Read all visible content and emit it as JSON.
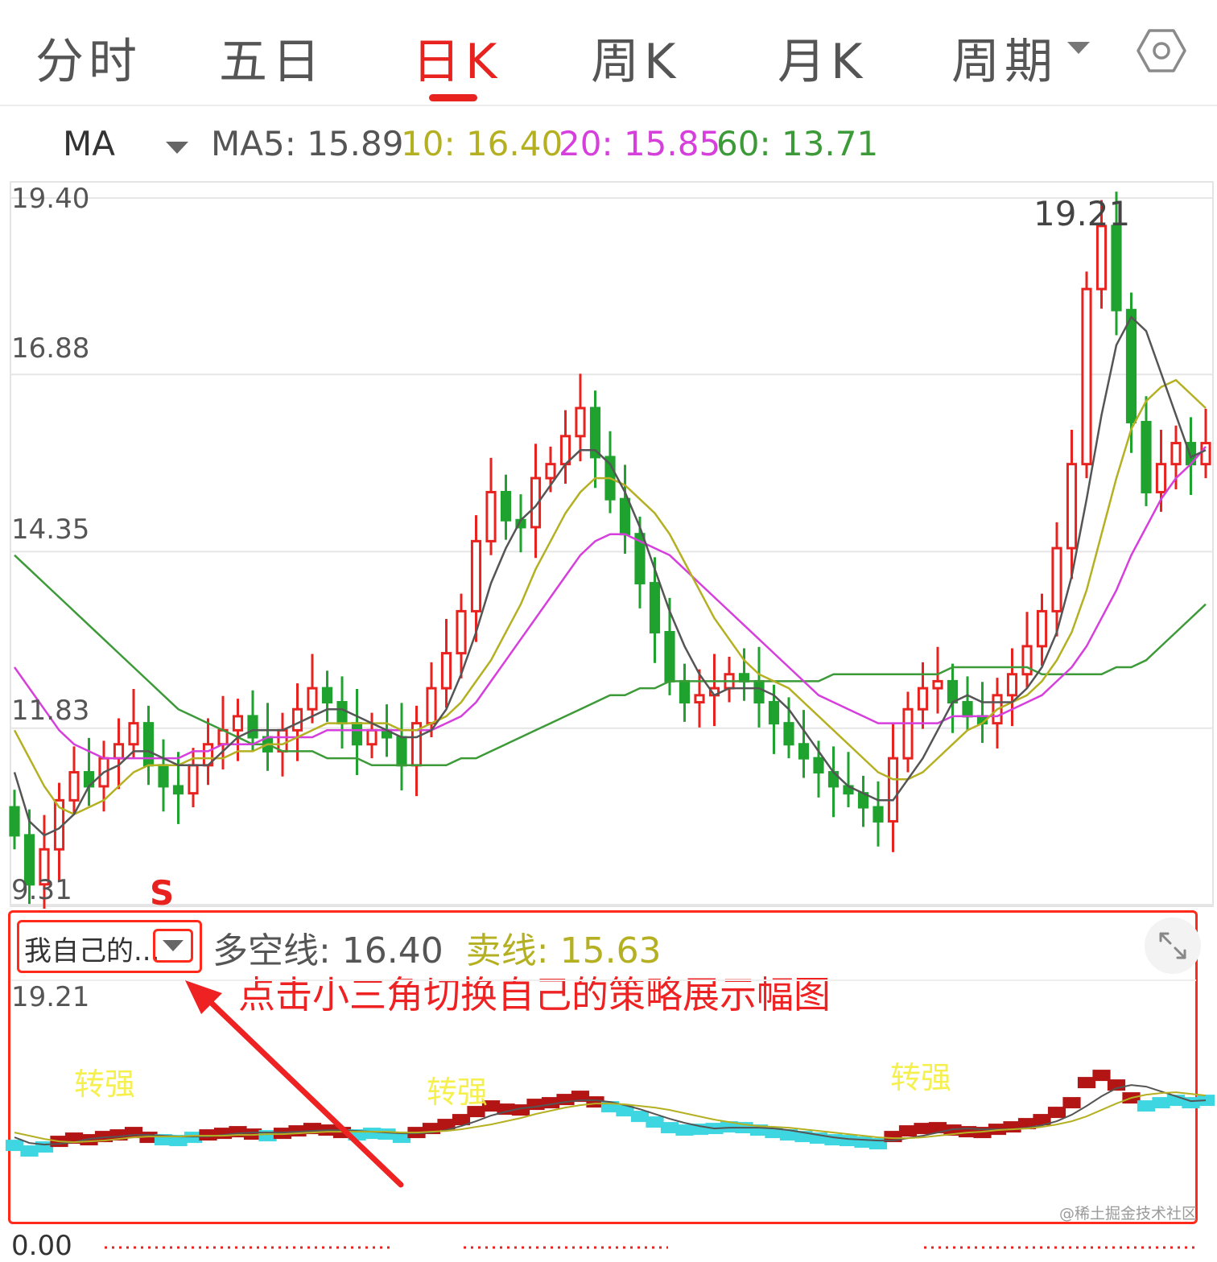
{
  "tabs": {
    "minute": "分时",
    "five_day": "五日",
    "day_k": "日K",
    "week_k": "周K",
    "month_k": "月K",
    "period": "周期"
  },
  "ma": {
    "label": "MA",
    "ma5": "MA5: 15.89",
    "ma10": "10: 16.40",
    "ma20": "20: 15.85",
    "ma60": "60: 13.71"
  },
  "colors": {
    "accent": "#e8231f",
    "candle_up": "#e8231f",
    "candle_down": "#1fa32e",
    "ma5": "#555555",
    "ma10": "#b5b022",
    "ma20": "#d63fdc",
    "ma60": "#3d9a38",
    "sub_strong": "#b31414",
    "sub_weak": "#3ed6e0",
    "annotation": "#ee2222"
  },
  "main_axis": {
    "tick_labels": [
      "19.40",
      "16.88",
      "14.35",
      "11.83",
      "9.31"
    ],
    "high_label": "19.21",
    "signal_label": "S"
  },
  "sub_panel": {
    "indicator_name": "我自己的...",
    "duokong": "多空线: 16.40",
    "maixian": "卖线: 15.63",
    "top_label": "19.21",
    "bottom_label": "0.00",
    "strong_label": "转强"
  },
  "annotation": "点击小三角切换自己的策略展示幅图",
  "watermark": "@稀土掘金技术社区",
  "icons": {
    "settings": "hexagon-settings-icon",
    "expand": "expand-arrows-icon",
    "caret": "caret-down-icon"
  },
  "chart_data": {
    "type": "candlestick",
    "ylim": [
      9.31,
      19.4
    ],
    "ticks": [
      19.4,
      16.88,
      14.35,
      11.83,
      9.31
    ],
    "close": [
      10.3,
      9.6,
      10.1,
      10.8,
      11.2,
      11.0,
      11.4,
      11.6,
      11.9,
      11.3,
      11.0,
      10.9,
      11.3,
      11.6,
      11.8,
      12.0,
      11.7,
      11.5,
      11.8,
      12.1,
      12.4,
      12.2,
      11.9,
      11.6,
      11.8,
      11.7,
      11.3,
      11.9,
      12.4,
      12.9,
      13.5,
      14.5,
      15.2,
      14.8,
      14.7,
      15.4,
      15.6,
      16.0,
      16.4,
      15.7,
      15.1,
      14.6,
      13.9,
      13.2,
      12.5,
      12.2,
      12.3,
      12.4,
      12.6,
      12.5,
      12.2,
      11.9,
      11.6,
      11.4,
      11.2,
      11.0,
      10.9,
      10.7,
      10.5,
      11.4,
      12.1,
      12.4,
      12.5,
      12.2,
      12.0,
      11.9,
      12.3,
      12.6,
      13.0,
      13.5,
      14.4,
      15.6,
      18.1,
      19.0,
      17.8,
      16.2,
      15.2,
      15.6,
      15.9,
      15.6,
      15.9
    ],
    "ma5": [
      11.2,
      10.5,
      10.3,
      10.4,
      10.6,
      11.0,
      11.2,
      11.3,
      11.5,
      11.5,
      11.4,
      11.3,
      11.3,
      11.3,
      11.5,
      11.7,
      11.8,
      11.8,
      11.8,
      11.9,
      12.0,
      12.1,
      12.1,
      12.0,
      11.9,
      11.8,
      11.7,
      11.7,
      11.8,
      12.1,
      12.6,
      13.2,
      13.9,
      14.4,
      14.8,
      15.0,
      15.3,
      15.6,
      15.8,
      15.8,
      15.6,
      15.2,
      14.7,
      14.1,
      13.5,
      13.0,
      12.6,
      12.3,
      12.4,
      12.4,
      12.4,
      12.3,
      12.1,
      11.8,
      11.5,
      11.2,
      11.0,
      10.9,
      10.8,
      10.8,
      11.1,
      11.4,
      11.8,
      12.2,
      12.3,
      12.2,
      12.2,
      12.2,
      12.4,
      12.7,
      13.2,
      14.0,
      15.1,
      16.3,
      17.3,
      17.7,
      17.5,
      16.9,
      16.3,
      15.7,
      15.8
    ],
    "ma10": [
      11.8,
      11.4,
      11.0,
      10.7,
      10.6,
      10.7,
      10.8,
      11.0,
      11.2,
      11.3,
      11.3,
      11.3,
      11.4,
      11.4,
      11.4,
      11.5,
      11.5,
      11.6,
      11.6,
      11.7,
      11.8,
      11.9,
      11.9,
      11.9,
      11.9,
      11.9,
      11.8,
      11.8,
      11.9,
      12.0,
      12.2,
      12.5,
      12.8,
      13.2,
      13.6,
      14.1,
      14.5,
      14.9,
      15.2,
      15.4,
      15.4,
      15.3,
      15.1,
      14.9,
      14.6,
      14.2,
      13.8,
      13.4,
      13.1,
      12.8,
      12.6,
      12.5,
      12.4,
      12.2,
      12.0,
      11.8,
      11.6,
      11.4,
      11.2,
      11.1,
      11.1,
      11.2,
      11.4,
      11.6,
      11.8,
      11.9,
      12.1,
      12.2,
      12.3,
      12.5,
      12.8,
      13.2,
      13.8,
      14.6,
      15.4,
      16.1,
      16.5,
      16.7,
      16.8,
      16.6,
      16.4
    ],
    "ma20": [
      12.7,
      12.4,
      12.1,
      11.8,
      11.6,
      11.5,
      11.4,
      11.4,
      11.4,
      11.4,
      11.4,
      11.4,
      11.5,
      11.5,
      11.6,
      11.6,
      11.6,
      11.7,
      11.7,
      11.7,
      11.7,
      11.8,
      11.8,
      11.8,
      11.8,
      11.8,
      11.8,
      11.8,
      11.8,
      11.9,
      12.0,
      12.2,
      12.5,
      12.8,
      13.1,
      13.4,
      13.7,
      14.0,
      14.3,
      14.5,
      14.6,
      14.6,
      14.5,
      14.4,
      14.3,
      14.1,
      13.9,
      13.7,
      13.5,
      13.3,
      13.1,
      12.9,
      12.7,
      12.5,
      12.3,
      12.2,
      12.1,
      12.0,
      11.9,
      11.9,
      11.9,
      11.9,
      11.9,
      12.0,
      12.0,
      12.0,
      12.0,
      12.1,
      12.2,
      12.3,
      12.5,
      12.7,
      13.0,
      13.4,
      13.8,
      14.3,
      14.7,
      15.1,
      15.4,
      15.6,
      15.85
    ],
    "ma60": [
      14.3,
      14.1,
      13.9,
      13.7,
      13.5,
      13.3,
      13.1,
      12.9,
      12.7,
      12.5,
      12.3,
      12.1,
      12.0,
      11.9,
      11.8,
      11.7,
      11.6,
      11.6,
      11.5,
      11.5,
      11.5,
      11.4,
      11.4,
      11.4,
      11.3,
      11.3,
      11.3,
      11.3,
      11.3,
      11.3,
      11.4,
      11.4,
      11.5,
      11.6,
      11.7,
      11.8,
      11.9,
      12.0,
      12.1,
      12.2,
      12.3,
      12.3,
      12.4,
      12.4,
      12.5,
      12.5,
      12.5,
      12.5,
      12.5,
      12.5,
      12.5,
      12.5,
      12.5,
      12.5,
      12.5,
      12.6,
      12.6,
      12.6,
      12.6,
      12.6,
      12.6,
      12.6,
      12.6,
      12.7,
      12.7,
      12.7,
      12.7,
      12.7,
      12.7,
      12.6,
      12.6,
      12.6,
      12.6,
      12.6,
      12.7,
      12.7,
      12.8,
      13.0,
      13.2,
      13.4,
      13.6
    ]
  }
}
